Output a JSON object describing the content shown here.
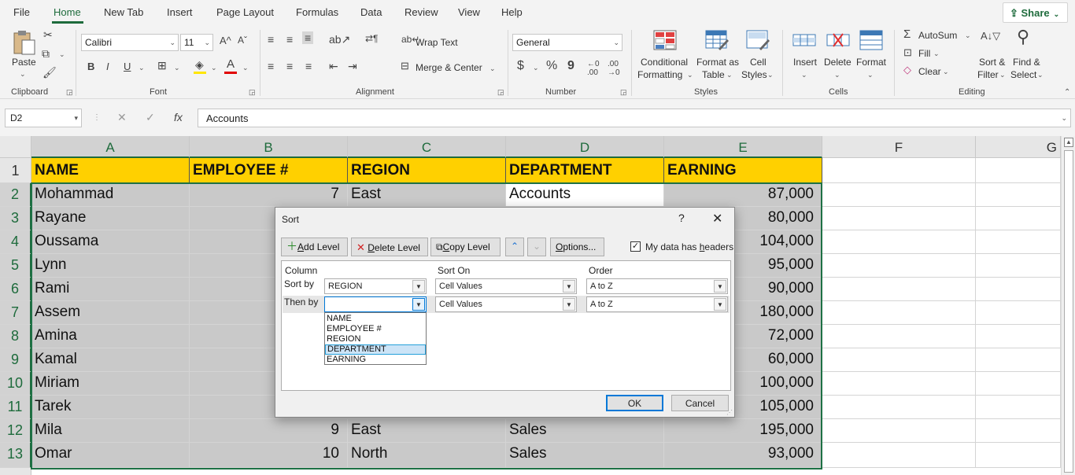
{
  "menu": {
    "tabs": [
      "File",
      "Home",
      "New Tab",
      "Insert",
      "Page Layout",
      "Formulas",
      "Data",
      "Review",
      "View",
      "Help"
    ],
    "active": "Home",
    "share": "Share"
  },
  "ribbon": {
    "clipboard": {
      "paste": "Paste",
      "group": "Clipboard"
    },
    "font": {
      "name": "Calibri",
      "size": "11",
      "bold": "B",
      "italic": "I",
      "underline": "U",
      "group": "Font"
    },
    "alignment": {
      "wrap_text": "Wrap Text",
      "merge_center": "Merge & Center",
      "group": "Alignment"
    },
    "number": {
      "format": "General",
      "currency": "$",
      "percent": "%",
      "comma": "9",
      "group": "Number"
    },
    "styles": {
      "conditional": "Conditional",
      "formatting": "Formatting",
      "format_as": "Format as",
      "table": "Table",
      "cell": "Cell",
      "styles_lbl": "Styles",
      "group": "Styles"
    },
    "cells": {
      "insert": "Insert",
      "delete": "Delete",
      "format": "Format",
      "group": "Cells"
    },
    "editing": {
      "autosum": "AutoSum",
      "fill": "Fill",
      "clear": "Clear",
      "sort": "Sort &",
      "filter": "Filter",
      "find": "Find &",
      "select": "Select",
      "group": "Editing"
    }
  },
  "formula_bar": {
    "name_box": "D2",
    "fx": "fx",
    "content": "Accounts"
  },
  "columns": [
    "A",
    "B",
    "C",
    "D",
    "E",
    "F",
    "G"
  ],
  "headers": [
    "NAME",
    "EMPLOYEE #",
    "REGION",
    "DEPARTMENT",
    "EARNING"
  ],
  "rows": [
    {
      "num": "1"
    },
    {
      "num": "2",
      "name": "Mohammad",
      "emp": "7",
      "region": "East",
      "dept": "Accounts",
      "earning": "87,000"
    },
    {
      "num": "3",
      "name": "Rayane",
      "earning": "80,000"
    },
    {
      "num": "4",
      "name": "Oussama",
      "earning": "104,000"
    },
    {
      "num": "5",
      "name": "Lynn",
      "earning": "95,000"
    },
    {
      "num": "6",
      "name": "Rami",
      "earning": "90,000"
    },
    {
      "num": "7",
      "name": "Assem",
      "earning": "180,000"
    },
    {
      "num": "8",
      "name": "Amina",
      "earning": "72,000"
    },
    {
      "num": "9",
      "name": "Kamal",
      "earning": "60,000"
    },
    {
      "num": "10",
      "name": "Miriam",
      "earning": "100,000"
    },
    {
      "num": "11",
      "name": "Tarek",
      "earning": "105,000"
    },
    {
      "num": "12",
      "name": "Mila",
      "emp": "9",
      "region": "East",
      "dept": "Sales",
      "earning": "195,000"
    },
    {
      "num": "13",
      "name": "Omar",
      "emp": "10",
      "region": "North",
      "dept": "Sales",
      "earning": "93,000"
    }
  ],
  "sort_dialog": {
    "title": "Sort",
    "help": "?",
    "close": "✕",
    "add_level_pre": "A",
    "add_level_rest": "dd Level",
    "delete_level_pre": "D",
    "delete_level_rest": "elete Level",
    "copy_level_pre": "C",
    "copy_level_rest": "opy Level",
    "options_pre": "O",
    "options_rest": "ptions...",
    "headers_label_pre": "My data has ",
    "headers_label_u": "h",
    "headers_label_rest": "eaders",
    "col_column": "Column",
    "col_sort_on": "Sort On",
    "col_order": "Order",
    "sort_by": "Sort by",
    "then_by": "Then by",
    "sort_by_value": "REGION",
    "then_by_value": "",
    "sort_on_1": "Cell Values",
    "sort_on_2": "Cell Values",
    "order_1": "A to Z",
    "order_2": "A to Z",
    "dropdown_options": [
      "NAME",
      "EMPLOYEE #",
      "REGION",
      "DEPARTMENT",
      "EARNING"
    ],
    "highlighted_option": "DEPARTMENT",
    "ok": "OK",
    "cancel": "Cancel"
  },
  "colors": {
    "accent": "#1e6b3c",
    "header_fill": "#ffd000",
    "selection_gray": "#c9c9c9",
    "focus_blue": "#0078d7"
  }
}
